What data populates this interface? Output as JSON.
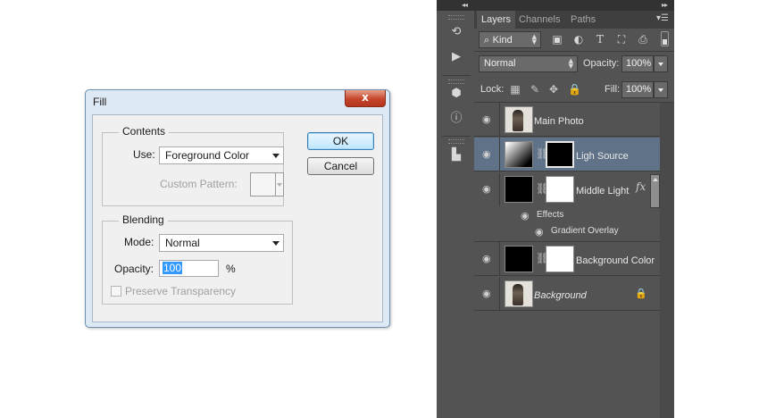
{
  "fill_dialog": {
    "title": "Fill",
    "close_label": "x",
    "contents": {
      "group_title": "Contents",
      "use_label": "Use:",
      "use_value": "Foreground Color",
      "custom_pattern_label": "Custom Pattern:"
    },
    "blending": {
      "group_title": "Blending",
      "mode_label": "Mode:",
      "mode_value": "Normal",
      "opacity_label": "Opacity:",
      "opacity_value": "100",
      "opacity_unit": "%",
      "preserve_transparency_label": "Preserve Transparency",
      "preserve_transparency_checked": false
    },
    "ok_label": "OK",
    "cancel_label": "Cancel"
  },
  "toolstrip": {
    "icons": [
      "history-brush-icon",
      "play-action-icon",
      "3d-cube-icon",
      "info-icon",
      "tool-presets-icon"
    ]
  },
  "layers_panel": {
    "tabs": [
      {
        "label": "Layers",
        "active": true
      },
      {
        "label": "Channels",
        "active": false
      },
      {
        "label": "Paths",
        "active": false
      }
    ],
    "filter_kind": "Kind",
    "blend_mode": "Normal",
    "opacity_label": "Opacity:",
    "opacity_value": "100%",
    "lock_label": "Lock:",
    "fill_label": "Fill:",
    "fill_value": "100%",
    "layers": [
      {
        "name": "Main Photo",
        "thumb": "photo",
        "selected": false
      },
      {
        "name": "Ligh Source",
        "thumb": "gradient",
        "mask": "black",
        "selected": true
      },
      {
        "name": "Middle Light",
        "thumb": "black",
        "mask": "white",
        "fx": "fx",
        "effects_label": "Effects",
        "effect_name": "Gradient Overlay"
      },
      {
        "name": "Background Color",
        "thumb": "black",
        "mask": "white"
      },
      {
        "name": "Background",
        "thumb": "photo",
        "locked": true
      }
    ]
  },
  "colors": {
    "panel_bg": "#535353",
    "selected_layer": "#5f7287",
    "selection_highlight": "#3399ff",
    "close_button": "#c4452a"
  }
}
